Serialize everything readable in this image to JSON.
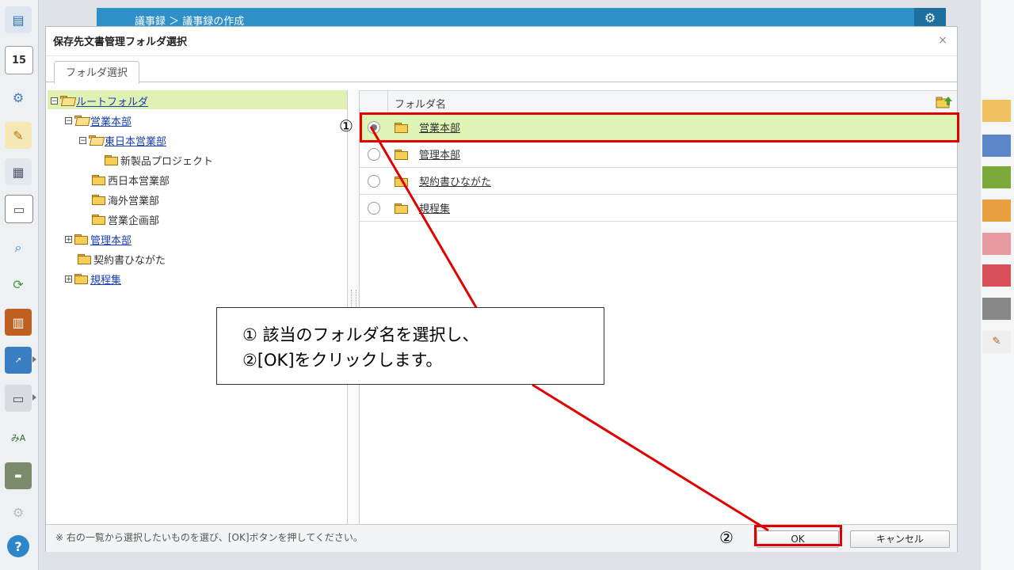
{
  "background_header": {
    "title": "議事録 ＞ 議事録の作成"
  },
  "dialog": {
    "title": "保存先文書管理フォルダ選択",
    "close_label": "×",
    "tab_label": "フォルダ選択"
  },
  "tree": {
    "nodes": [
      {
        "label": "ルートフォルダ",
        "toggle": "⊟",
        "link": true
      },
      {
        "label": "営業本部",
        "toggle": "⊟",
        "link": true
      },
      {
        "label": "東日本営業部",
        "toggle": "⊟",
        "link": true
      },
      {
        "label": "新製品プロジェクト",
        "toggle": "",
        "link": false
      },
      {
        "label": "西日本営業部",
        "toggle": "",
        "link": false
      },
      {
        "label": "海外営業部",
        "toggle": "",
        "link": false
      },
      {
        "label": "営業企画部",
        "toggle": "",
        "link": false
      },
      {
        "label": "管理本部",
        "toggle": "⊞",
        "link": true
      },
      {
        "label": "契約書ひながた",
        "toggle": "",
        "link": false
      },
      {
        "label": "規程集",
        "toggle": "⊞",
        "link": true
      }
    ]
  },
  "list": {
    "header": "フォルダ名",
    "rows": [
      {
        "name": "営業本部",
        "selected": true
      },
      {
        "name": "管理本部",
        "selected": false
      },
      {
        "name": "契約書ひながた",
        "selected": false
      },
      {
        "name": "規程集",
        "selected": false
      }
    ]
  },
  "footer": {
    "message": "※ 右の一覧から選択したいものを選び、[OK]ボタンを押してください。",
    "ok_label": "OK",
    "cancel_label": "キャンセル"
  },
  "annotation": {
    "mark1": "①",
    "mark2": "②",
    "line1": "① 該当のフォルダ名を選択し、",
    "line2": "②[OK]をクリックします。"
  },
  "colors": {
    "highlight": "#e00000",
    "selected_row": "#dff5b5",
    "header_blue": "#2f8fc7"
  }
}
